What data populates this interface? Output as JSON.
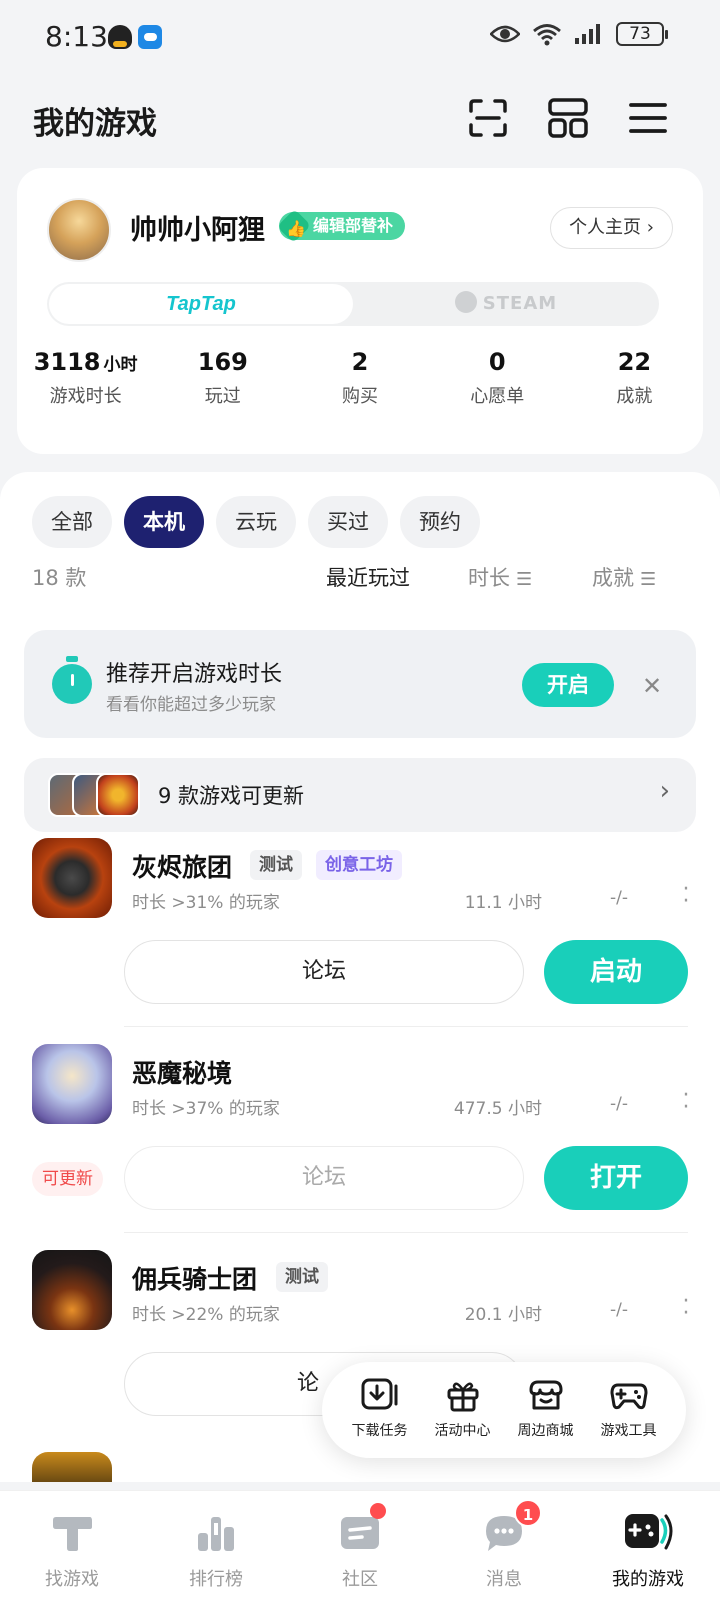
{
  "status_bar": {
    "time": "8:13",
    "battery": "73"
  },
  "header": {
    "title": "我的游戏"
  },
  "profile": {
    "username": "帅帅小阿狸",
    "badge": "编辑部替补",
    "homepage_button": "个人主页",
    "platforms": {
      "taptap": "TapTap",
      "steam": "STEAM"
    },
    "stats": [
      {
        "value": "3118",
        "unit": "小时",
        "label": "游戏时长"
      },
      {
        "value": "169",
        "unit": "",
        "label": "玩过"
      },
      {
        "value": "2",
        "unit": "",
        "label": "购买"
      },
      {
        "value": "0",
        "unit": "",
        "label": "心愿单"
      },
      {
        "value": "22",
        "unit": "",
        "label": "成就"
      }
    ]
  },
  "filters": {
    "items": [
      "全部",
      "本机",
      "云玩",
      "买过",
      "预约"
    ],
    "active": "本机"
  },
  "sortbar": {
    "count": "18 款",
    "recent": "最近玩过",
    "duration": "时长",
    "achievements": "成就"
  },
  "timer_banner": {
    "title": "推荐开启游戏时长",
    "subtitle": "看看你能超过多少玩家",
    "button": "开启"
  },
  "update_banner": {
    "text": "9 款游戏可更新"
  },
  "games": [
    {
      "name": "灰烬旅团",
      "tags": [
        "测试",
        "创意工坊"
      ],
      "percentile": "时长 >31% 的玩家",
      "hours": "11.1 小时",
      "achievements": "-/-",
      "forum": "论坛",
      "action": "启动",
      "updatable": ""
    },
    {
      "name": "恶魔秘境",
      "tags": [],
      "percentile": "时长 >37% 的玩家",
      "hours": "477.5 小时",
      "achievements": "-/-",
      "forum": "论坛",
      "action": "打开",
      "updatable": "可更新"
    },
    {
      "name": "佣兵骑士团",
      "tags": [
        "测试"
      ],
      "percentile": "时长 >22% 的玩家",
      "hours": "20.1 小时",
      "achievements": "-/-",
      "forum": "论",
      "action": "",
      "updatable": ""
    }
  ],
  "quick_tools": [
    {
      "label": "下载任务",
      "icon": "download-icon"
    },
    {
      "label": "活动中心",
      "icon": "gift-icon"
    },
    {
      "label": "周边商城",
      "icon": "store-icon"
    },
    {
      "label": "游戏工具",
      "icon": "gamepad-icon"
    }
  ],
  "bottom_nav": [
    {
      "label": "找游戏",
      "icon": "find-games-icon"
    },
    {
      "label": "排行榜",
      "icon": "ranking-icon"
    },
    {
      "label": "社区",
      "icon": "community-icon"
    },
    {
      "label": "消息",
      "icon": "message-icon",
      "badge": "1"
    },
    {
      "label": "我的游戏",
      "icon": "my-games-icon"
    }
  ],
  "colors": {
    "accent": "#19cfba",
    "chip_active": "#1e2170",
    "badge_red": "#ff4d4f",
    "workshop_purple": "#7a63e8"
  }
}
